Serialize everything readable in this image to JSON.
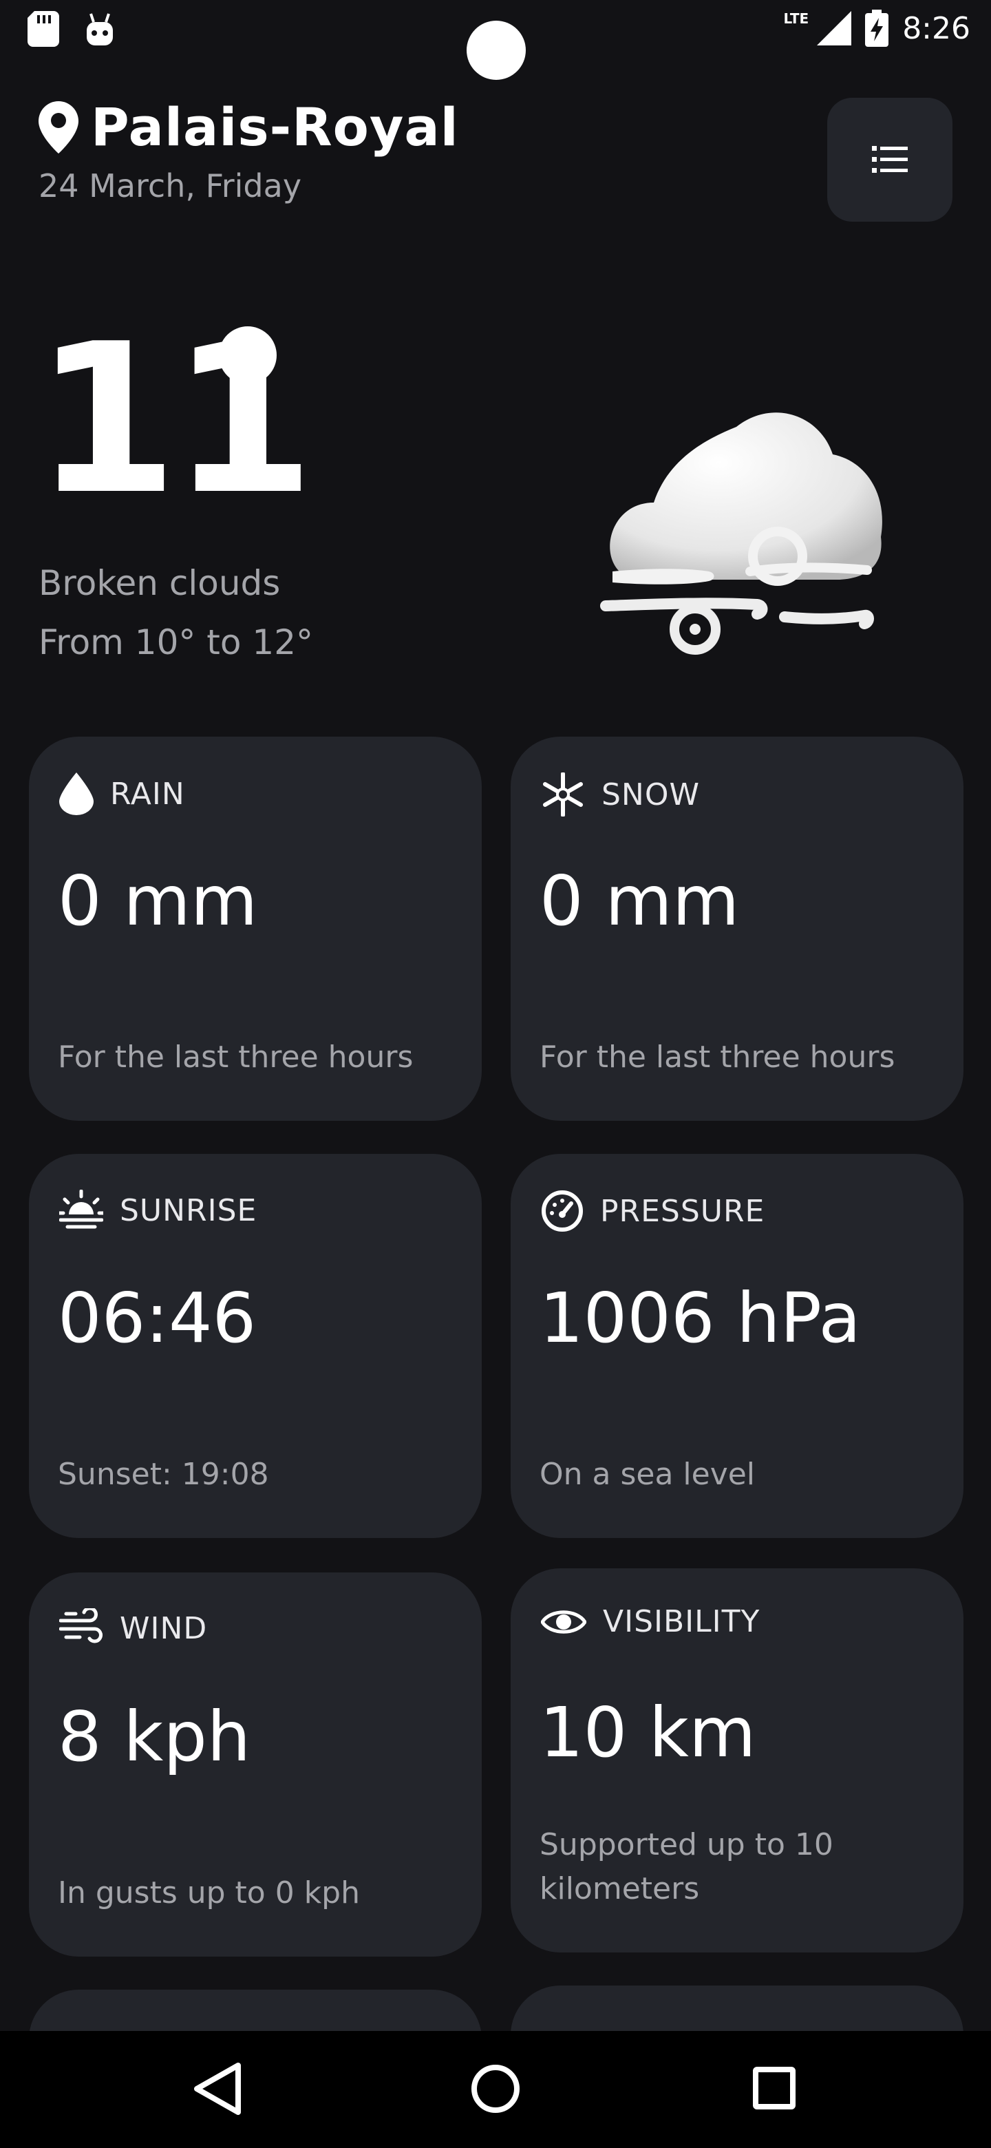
{
  "status_bar": {
    "network": "LTE",
    "time": "8:26"
  },
  "header": {
    "location": "Palais-Royal",
    "date": "24 March, Friday"
  },
  "weather": {
    "temperature": "11",
    "condition": "Broken clouds",
    "range": "From 10° to 12°"
  },
  "cards": [
    {
      "label": "RAIN",
      "value": "0 mm",
      "note": "For the last three hours",
      "icon": "raindrop-icon"
    },
    {
      "label": "SNOW",
      "value": "0 mm",
      "note": "For the last three hours",
      "icon": "snowflake-icon"
    },
    {
      "label": "SUNRISE",
      "value": "06:46",
      "note": "Sunset: 19:08",
      "icon": "sunrise-icon"
    },
    {
      "label": "PRESSURE",
      "value": "1006 hPa",
      "note": "On a sea level",
      "icon": "gauge-icon"
    },
    {
      "label": "WIND",
      "value": "8 kph",
      "note": "In gusts up to 0 kph",
      "icon": "wind-icon"
    },
    {
      "label": "VISIBILITY",
      "value": "10 km",
      "note": "Supported up to 10 kilometers",
      "icon": "eye-icon"
    }
  ]
}
